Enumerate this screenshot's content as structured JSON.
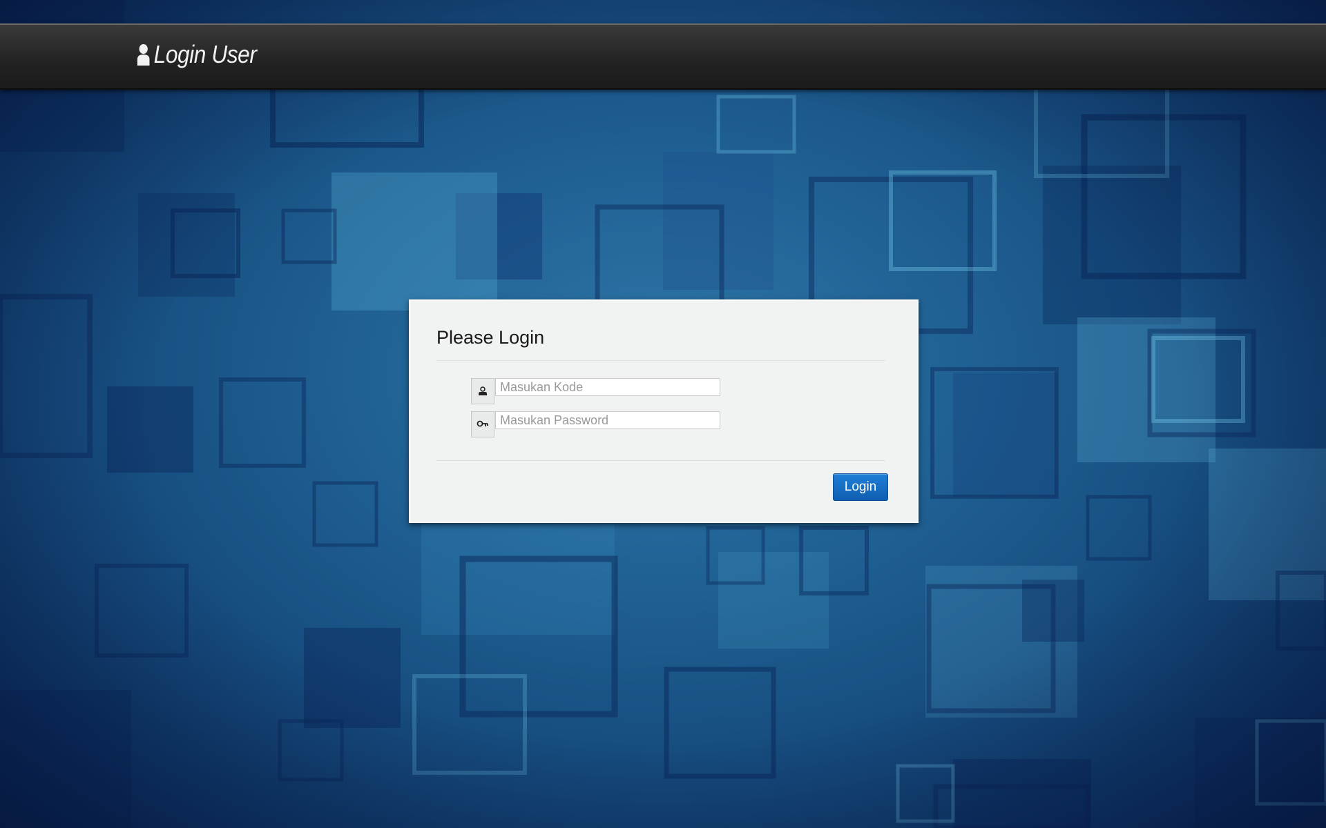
{
  "navbar": {
    "brand": "Login User",
    "brand_icon": "user-icon"
  },
  "login_panel": {
    "title": "Please Login",
    "kode_field": {
      "value": "",
      "placeholder": "Masukan Kode",
      "icon": "user-badge-icon"
    },
    "password_field": {
      "value": "",
      "placeholder": "Masukan Password",
      "icon": "key-icon"
    },
    "submit_label": "Login"
  },
  "colors": {
    "navbar": "#222222",
    "background": "#1f5f92",
    "panel": "#f1f2f2",
    "primary_button": "#1371c7"
  }
}
